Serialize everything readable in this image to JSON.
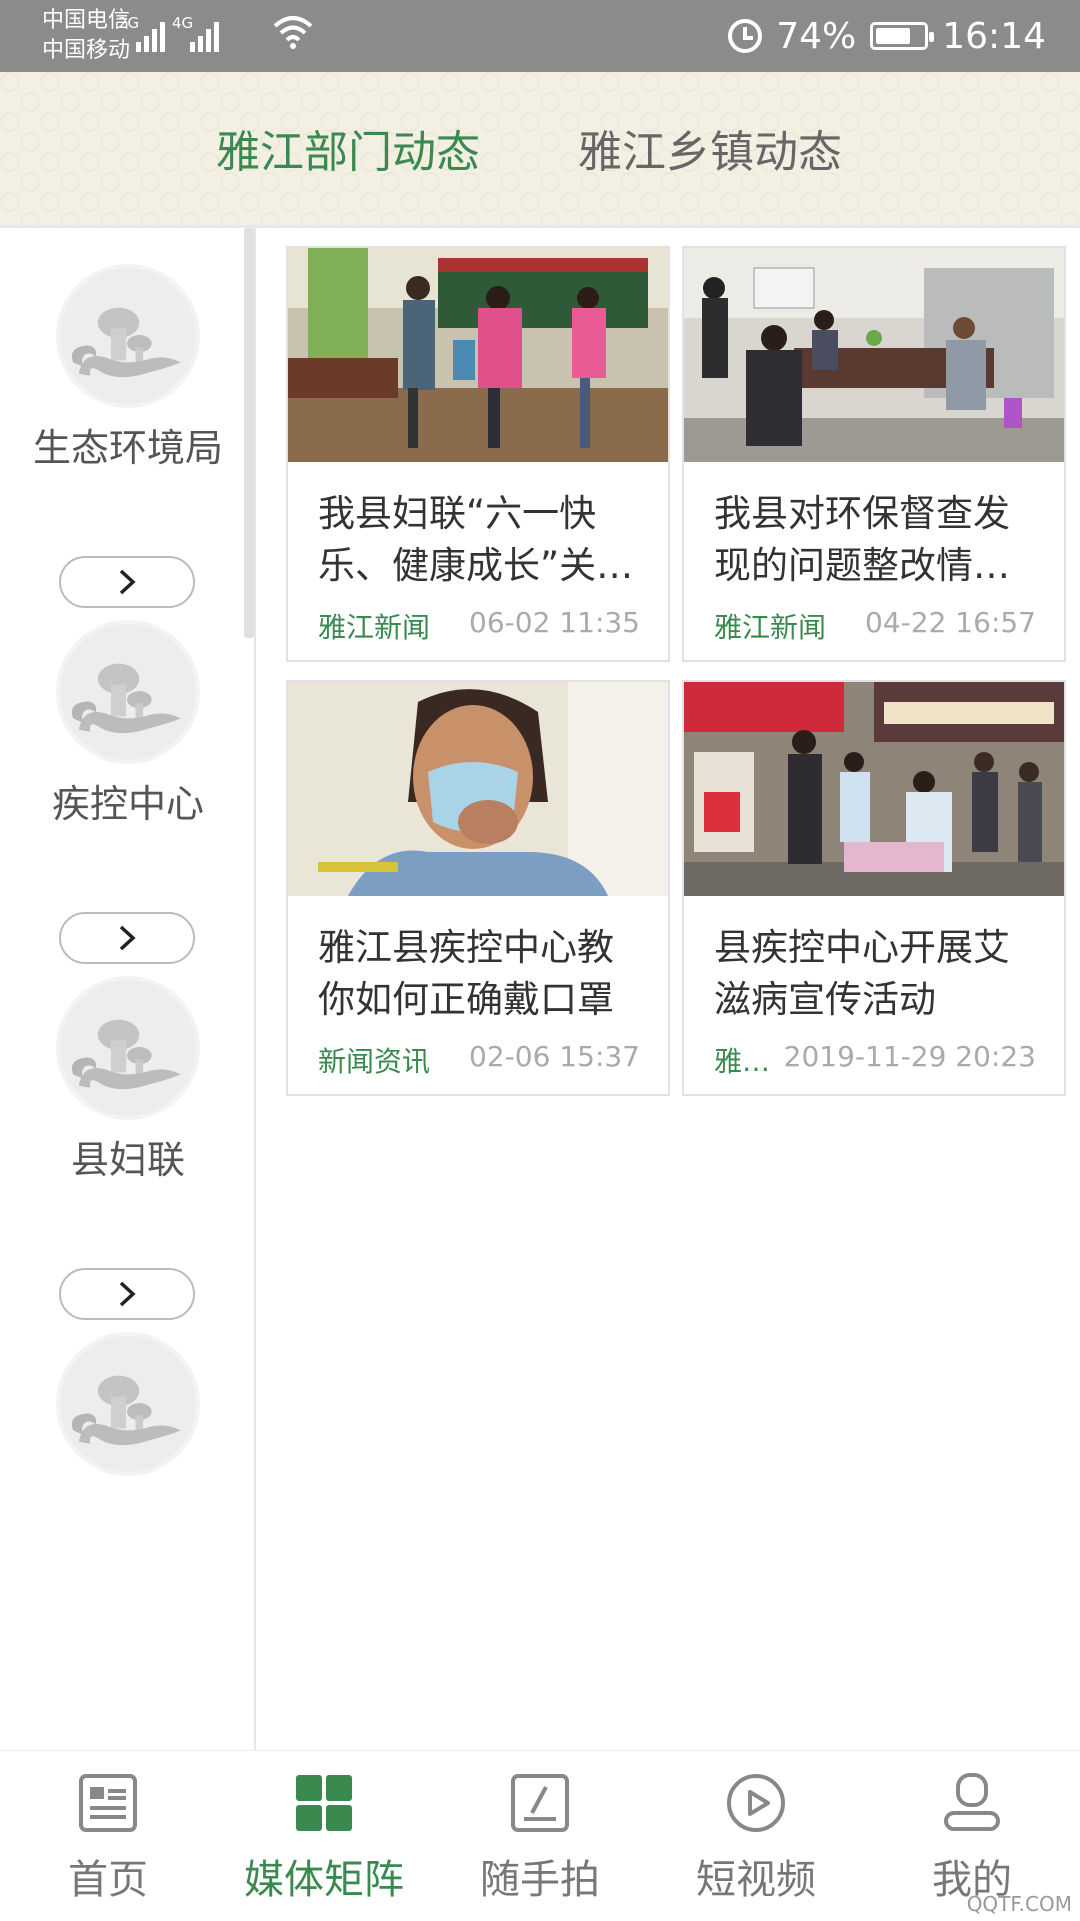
{
  "status_bar": {
    "carrier1": "中国电信",
    "carrier2": "中国移动",
    "sig1": "2G",
    "sig2": "4G",
    "battery": "74%",
    "battery_level": 0.74,
    "time": "16:14"
  },
  "tabs": [
    {
      "label": "雅江部门动态",
      "active": true
    },
    {
      "label": "雅江乡镇动态",
      "active": false
    }
  ],
  "sidebar": {
    "items": [
      {
        "name": "生态环境局"
      },
      {
        "name": "疾控中心"
      },
      {
        "name": "县妇联"
      }
    ]
  },
  "news": [
    {
      "title": "我县妇联“六一快乐、健康成长”关…",
      "source": "雅江新闻",
      "time": "06-02 11:35"
    },
    {
      "title": "我县对环保督查发现的问题整改情…",
      "source": "雅江新闻",
      "time": "04-22 16:57"
    },
    {
      "title": "雅江县疾控中心教你如何正确戴口罩",
      "source": "新闻资讯",
      "time": "02-06 15:37"
    },
    {
      "title": "县疾控中心开展艾滋病宣传活动",
      "source": "雅…",
      "time": "2019-11-29 20:23"
    }
  ],
  "bottom_nav": [
    {
      "label": "首页",
      "icon": "news-icon",
      "active": false
    },
    {
      "label": "媒体矩阵",
      "icon": "grid-icon",
      "active": true
    },
    {
      "label": "随手拍",
      "icon": "edit-icon",
      "active": false
    },
    {
      "label": "短视频",
      "icon": "play-icon",
      "active": false
    },
    {
      "label": "我的",
      "icon": "user-icon",
      "active": false
    }
  ],
  "watermark": "QQTF.COM",
  "colors": {
    "accent": "#3a8a50",
    "statusbar": "#8b8b8b"
  }
}
